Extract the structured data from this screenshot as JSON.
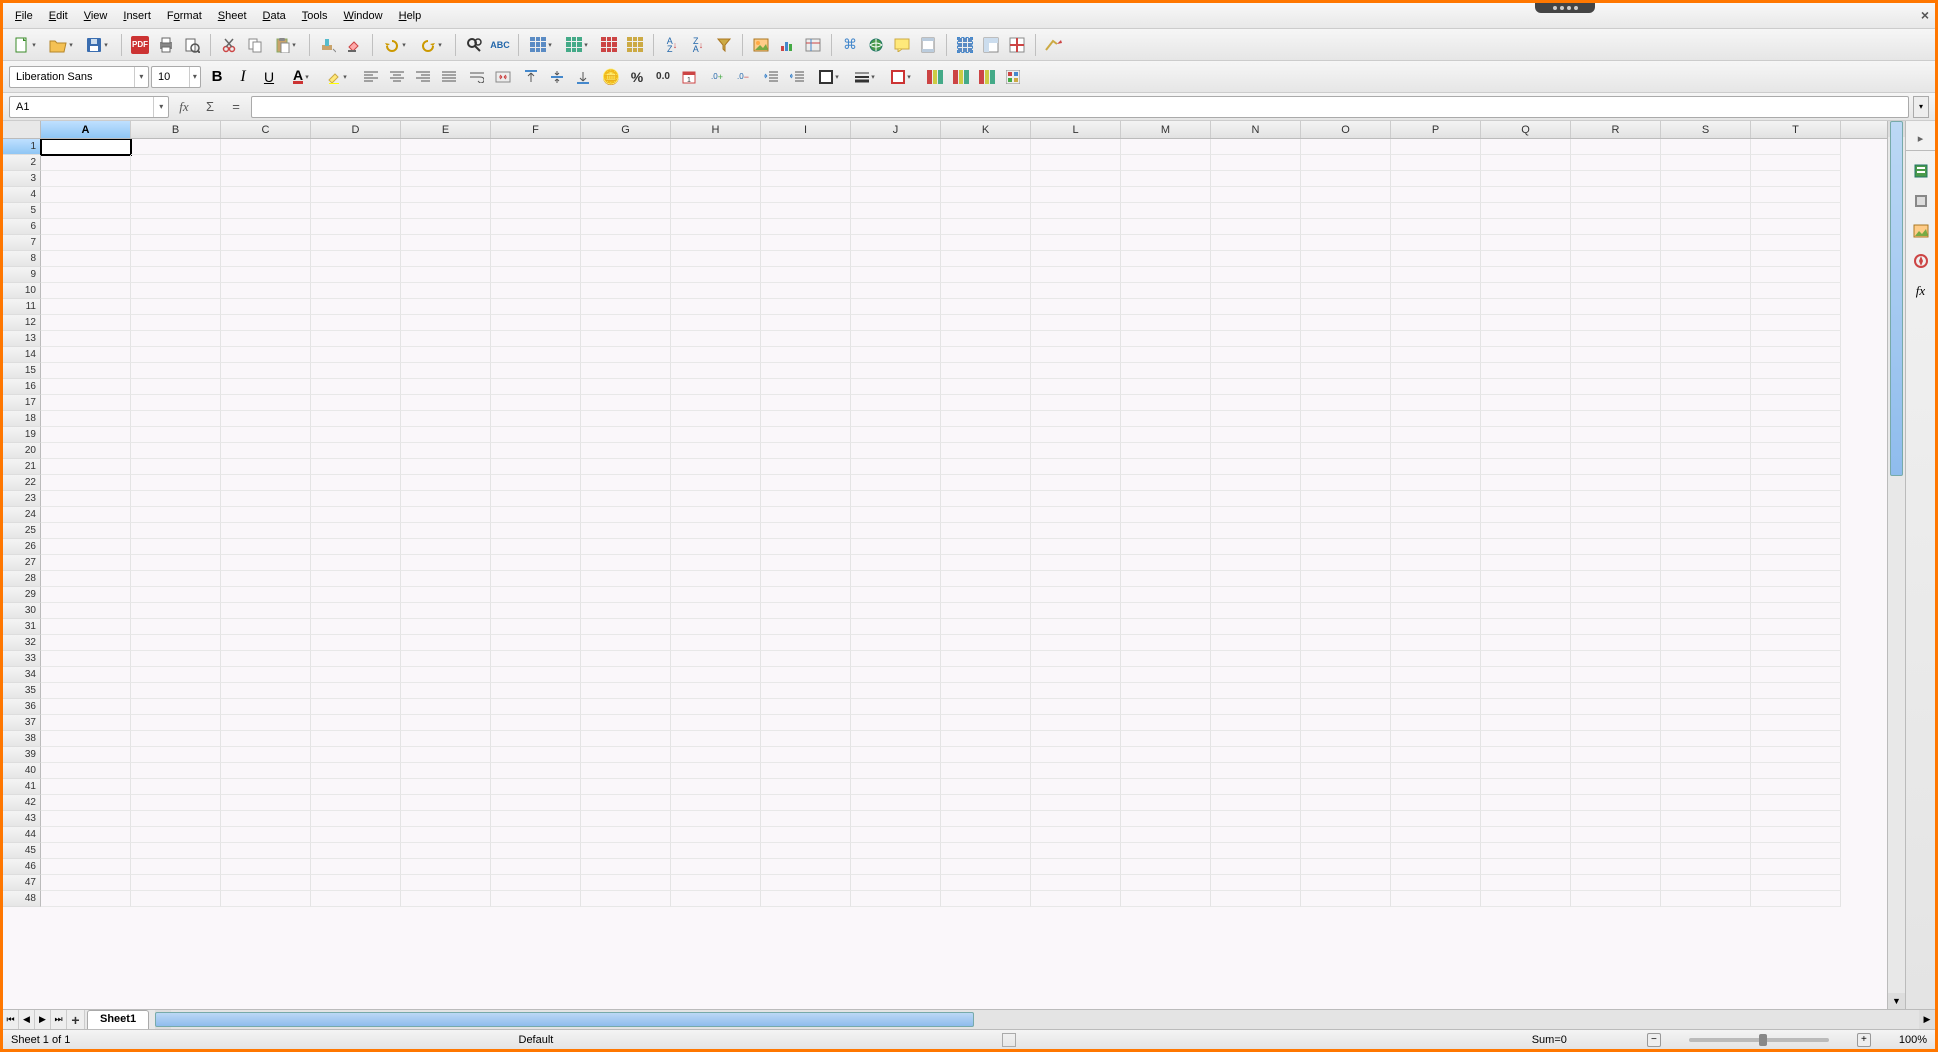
{
  "menu": {
    "file": "File",
    "edit": "Edit",
    "view": "View",
    "insert": "Insert",
    "format": "Format",
    "sheet": "Sheet",
    "data": "Data",
    "tools": "Tools",
    "window": "Window",
    "help": "Help"
  },
  "toolbar1": {
    "pdf_label": "PDF"
  },
  "format_bar": {
    "font_name": "Liberation Sans",
    "font_size": "10",
    "bold": "B",
    "italic": "I",
    "underline": "U",
    "font_color_letter": "A",
    "percent": "%",
    "number_format": "0.0",
    "add_decimal": ".000",
    "remove_decimal": ".000"
  },
  "formula_bar": {
    "cell_ref": "A1",
    "fx": "fx",
    "sum": "Σ",
    "eq": "=",
    "formula_value": ""
  },
  "columns": [
    "A",
    "B",
    "C",
    "D",
    "E",
    "F",
    "G",
    "H",
    "I",
    "J",
    "K",
    "L",
    "M",
    "N",
    "O",
    "P",
    "Q",
    "R",
    "S",
    "T"
  ],
  "row_count": 48,
  "active_cell": {
    "col": 0,
    "row": 0
  },
  "tabs": {
    "sheet1": "Sheet1",
    "add": "+"
  },
  "status": {
    "sheet_info": "Sheet 1 of 1",
    "style": "Default",
    "sum": "Sum=0",
    "zoom": "100%",
    "minus": "−",
    "plus": "+"
  },
  "sidebar": {
    "expand": "▸"
  }
}
